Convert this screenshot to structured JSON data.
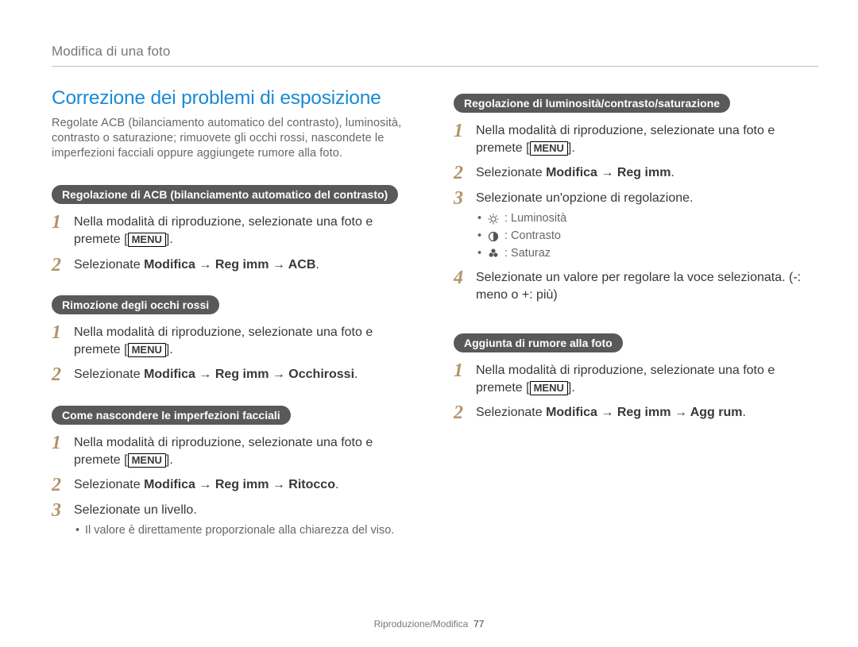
{
  "header": "Modifica di una foto",
  "title": "Correzione dei problemi di esposizione",
  "intro": "Regolate ACB (bilanciamento automatico del contrasto), luminosità, contrasto o saturazione; rimuovete gli occhi rossi, nascondete le imperfezioni facciali oppure aggiungete rumore alla foto.",
  "menuLabel": "MENU",
  "arrow": "→",
  "sections": {
    "acb": {
      "pill": "Regolazione di ACB (bilanciamento automatico del contrasto)",
      "step1a": "Nella modalità di riproduzione, selezionate una foto e premete [",
      "step1b": "].",
      "step2pre": "Selezionate ",
      "step2bold": "Modifica → Reg imm → ACB",
      "step2post": "."
    },
    "redeye": {
      "pill": "Rimozione degli occhi rossi",
      "step1a": "Nella modalità di riproduzione, selezionate una foto e premete [",
      "step1b": "].",
      "step2pre": "Selezionate ",
      "step2bold": "Modifica → Reg imm → Occhirossi",
      "step2post": "."
    },
    "face": {
      "pill": "Come nascondere le imperfezioni facciali",
      "step1a": "Nella modalità di riproduzione, selezionate una foto e premete [",
      "step1b": "].",
      "step2pre": "Selezionate ",
      "step2bold": "Modifica → Reg imm → Ritocco",
      "step2post": ".",
      "step3": "Selezionate un livello.",
      "note": "Il valore è direttamente proporzionale alla chiarezza del viso."
    },
    "bcs": {
      "pill": "Regolazione di luminosità/contrasto/saturazione",
      "step1a": "Nella modalità di riproduzione, selezionate una foto e premete [",
      "step1b": "].",
      "step2pre": "Selezionate ",
      "step2bold": "Modifica → Reg imm",
      "step2post": ".",
      "step3": "Selezionate un'opzione di regolazione.",
      "opts": {
        "lum": ": Luminosità",
        "con": ": Contrasto",
        "sat": ": Saturaz"
      },
      "step4": "Selezionate un valore per regolare la voce selezionata. (-: meno o +: più)"
    },
    "noise": {
      "pill": "Aggiunta di rumore alla foto",
      "step1a": "Nella modalità di riproduzione, selezionate una foto e premete [",
      "step1b": "].",
      "step2pre": "Selezionate ",
      "step2bold": "Modifica → Reg imm → Agg rum",
      "step2post": "."
    }
  },
  "footer": {
    "section": "Riproduzione/Modifica",
    "page": "77"
  }
}
